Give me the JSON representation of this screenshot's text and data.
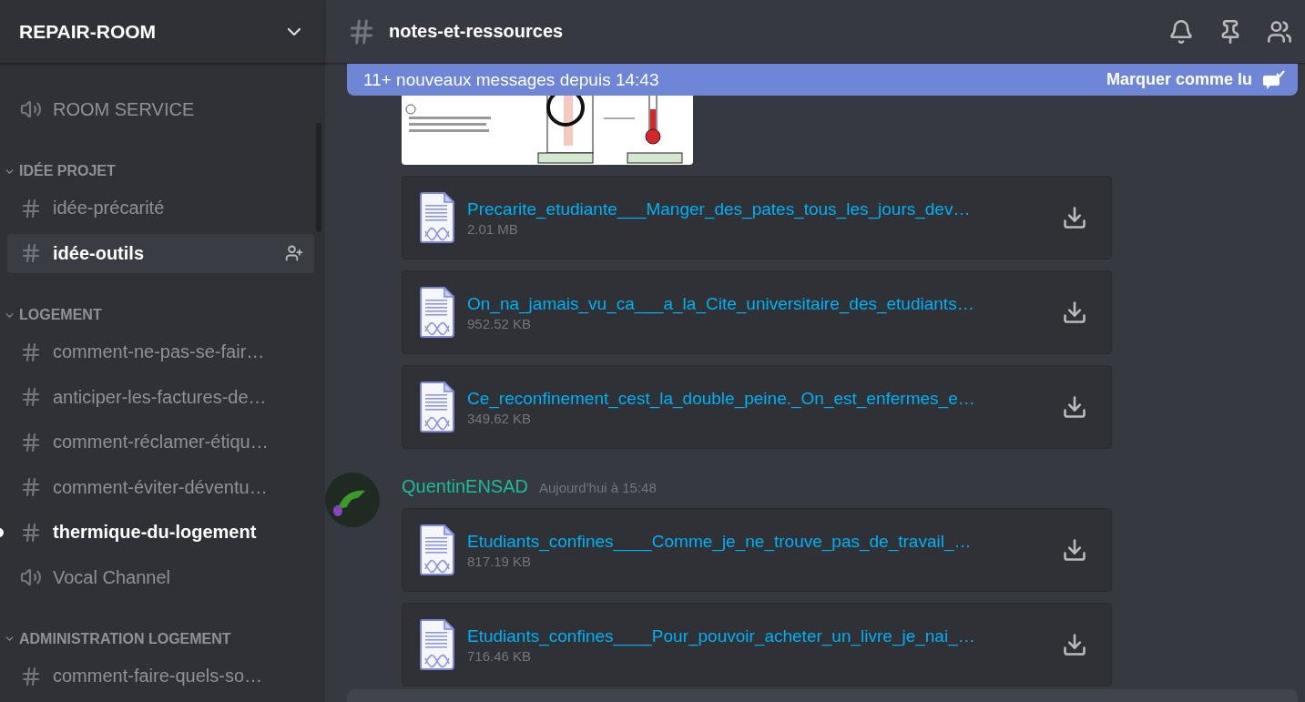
{
  "server": {
    "name": "REPAIR-ROOM"
  },
  "sidebar": {
    "entries": [
      {
        "kind": "voice",
        "name": "ROOM SERVICE",
        "selected": false,
        "unread": false
      },
      {
        "kind": "category",
        "name": "IDÉE PROJET",
        "expanded": true,
        "channels": [
          {
            "kind": "text",
            "name": "idée-précarité",
            "selected": false,
            "unread": false
          },
          {
            "kind": "text",
            "name": "idée-outils",
            "selected": true,
            "unread": false
          }
        ]
      },
      {
        "kind": "category",
        "name": "LOGEMENT",
        "expanded": true,
        "channels": [
          {
            "kind": "text",
            "name": "comment-ne-pas-se-fair…",
            "selected": false,
            "unread": false
          },
          {
            "kind": "text",
            "name": "anticiper-les-factures-de…",
            "selected": false,
            "unread": false
          },
          {
            "kind": "text",
            "name": "comment-réclamer-étiqu…",
            "selected": false,
            "unread": false
          },
          {
            "kind": "text",
            "name": "comment-éviter-déventu…",
            "selected": false,
            "unread": false
          },
          {
            "kind": "text",
            "name": "thermique-du-logement",
            "selected": false,
            "unread": true
          },
          {
            "kind": "voice",
            "name": "Vocal Channel",
            "selected": false,
            "unread": false
          }
        ]
      },
      {
        "kind": "category",
        "name": "ADMINISTRATION LOGEMENT",
        "expanded": true,
        "channels": [
          {
            "kind": "text",
            "name": "comment-faire-quels-so…",
            "selected": false,
            "unread": false
          }
        ]
      }
    ]
  },
  "channel": {
    "name": "notes-et-ressources"
  },
  "banner": {
    "text": "11+ nouveaux messages depuis 14:43",
    "action": "Marquer comme lu"
  },
  "messages": [
    {
      "kind": "continuation",
      "image": {
        "kind": "picture"
      },
      "attachments": [
        {
          "name": "Precarite_etudiante___Manger_des_pates_tous_les_jours_dev…",
          "size": "2.01 MB"
        },
        {
          "name": "On_na_jamais_vu_ca___a_la_Cite_universitaire_des_etudiants…",
          "size": "952.52 KB"
        },
        {
          "name": "Ce_reconfinement_cest_la_double_peine._On_est_enfermes_e…",
          "size": "349.62 KB"
        }
      ]
    },
    {
      "kind": "group",
      "author": "QuentinENSAD",
      "timestamp": "Aujourd'hui à 15:48",
      "attachments": [
        {
          "name": "Etudiants_confines____Comme_je_ne_trouve_pas_de_travail_…",
          "size": "817.19 KB"
        },
        {
          "name": "Etudiants_confines____Pour_pouvoir_acheter_un_livre_je_nai_…",
          "size": "716.46 KB"
        }
      ]
    }
  ]
}
